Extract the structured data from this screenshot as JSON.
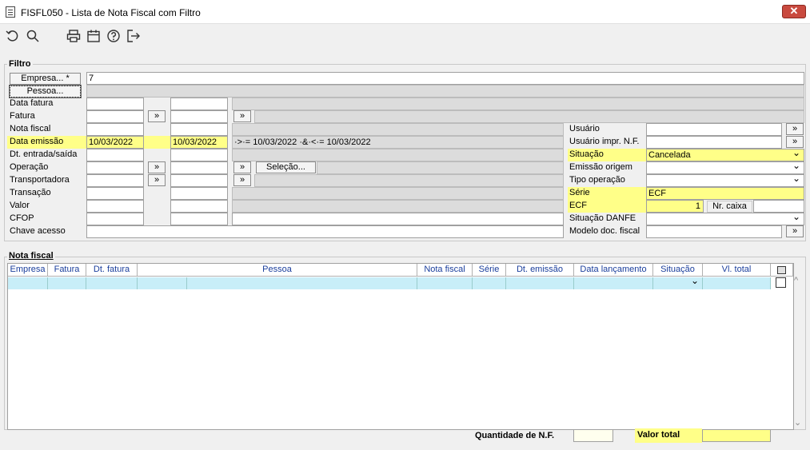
{
  "window": {
    "title": "FISFL050 - Lista de Nota Fiscal com Filtro",
    "close_glyph": "✕"
  },
  "toolbar": {
    "icons": [
      "undo-icon",
      "search-icon",
      "print-icon",
      "calendar-icon",
      "help-icon",
      "exit-icon"
    ]
  },
  "filtro": {
    "title": "Filtro",
    "empresa_btn": "Empresa... *",
    "empresa_value": "7",
    "pessoa_btn": "Pessoa...",
    "labels": {
      "data_fatura": "Data fatura",
      "fatura": "Fatura",
      "nota_fiscal": "Nota fiscal",
      "data_emissao": "Data emissão",
      "dt_entrada": "Dt. entrada/saída",
      "operacao": "Operação",
      "transportadora": "Transportadora",
      "transacao": "Transação",
      "valor": "Valor",
      "cfop": "CFOP",
      "chave_acesso": "Chave acesso"
    },
    "data_emissao_from": "10/03/2022",
    "data_emissao_to": "10/03/2022",
    "data_emissao_expr": "·>·= 10/03/2022 ·&·<·= 10/03/2022",
    "arrow": "»",
    "selecao_btn": "Seleção...",
    "right_labels": {
      "usuario": "Usuário",
      "usuario_impr": "Usuário impr. N.F.",
      "situacao": "Situação",
      "emissao_origem": "Emissão origem",
      "tipo_operacao": "Tipo operação",
      "serie": "Série",
      "ecf": "ECF",
      "situacao_danfe": "Situação DANFE",
      "modelo_doc": "Modelo doc. fiscal"
    },
    "situacao_value": "Cancelada",
    "serie_value": "ECF",
    "ecf_value": "1",
    "nr_caixa_label": "Nr. caixa"
  },
  "nota_fiscal": {
    "title": "Nota fiscal",
    "columns": [
      "Empresa",
      "Fatura",
      "Dt. fatura",
      "Pessoa",
      "Nota fiscal",
      "Série",
      "Dt. emissão",
      "Data lançamento",
      "Situação",
      "Vl. total"
    ]
  },
  "footer": {
    "quantidade_label": "Quantidade de N.F.",
    "valor_total_label": "Valor total"
  }
}
